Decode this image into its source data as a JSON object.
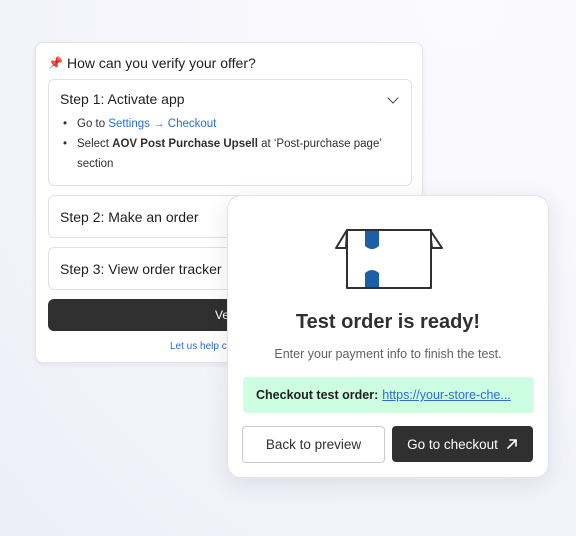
{
  "verify_card": {
    "title": "How can you verify your offer?",
    "steps": [
      {
        "label": "Step 1: Activate app",
        "bullets": {
          "b1_prefix": "Go to ",
          "b1_link": "Settings → Checkout",
          "b2_prefix": "Select ",
          "b2_bold": "AOV Post Purchase Upsell",
          "b2_suffix": " at ‘Post-purchase page’",
          "b2_line2": "section"
        }
      },
      {
        "label": "Step 2: Make an order"
      },
      {
        "label": "Step 3: View order tracker"
      }
    ],
    "verify_button": "Verify",
    "help_link": "Let us help c"
  },
  "test_order_modal": {
    "title": "Test order is ready!",
    "subtitle": "Enter your payment info to finish the test.",
    "checkout_label": "Checkout test order:",
    "checkout_url": "https://your-store-che...",
    "back_button": "Back to preview",
    "checkout_button": "Go to checkout",
    "colors": {
      "accent_blue": "#1d5fa6",
      "banner_green": "#cdfee1",
      "dark_button": "#303030"
    }
  }
}
